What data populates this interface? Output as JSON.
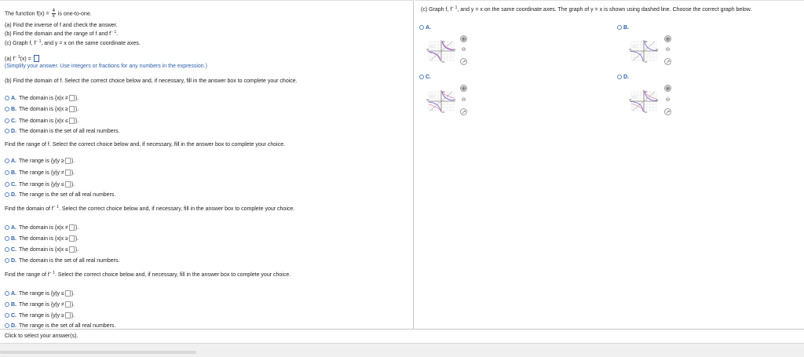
{
  "problem": {
    "intro_prefix": "The function f(x) =",
    "intro_frac_num": "4",
    "intro_frac_den": "x",
    "intro_suffix": "is one-to-one.",
    "part_a": "(a) Find the inverse of f and check the answer.",
    "part_b_prefix": "(b) Find the domain and the range of f and f",
    "part_c_prefix": "(c) Graph f, f",
    "part_c_suffix": ", and y = x on the same coordinate axes.",
    "superscript": "− 1",
    "part_b_suffix": "."
  },
  "answer_a": {
    "prefix": "(a) f",
    "suffix": "(x) =",
    "hint": "(Simplify your answer. Use integers or fractions for any numbers in the expression.)"
  },
  "question_domain_f": "(b) Find the domain of f. Select the correct choice below and, if necessary, fill in the answer box to complete your choice.",
  "options_domain_f": [
    {
      "letter": "A.",
      "text": "The domain is {x|x ≠",
      "end": "}."
    },
    {
      "letter": "B.",
      "text": "The domain is {x|x ≥",
      "end": "}."
    },
    {
      "letter": "C.",
      "text": "The domain is {x|x ≤",
      "end": "}."
    },
    {
      "letter": "D.",
      "text": "The domain is the set of all real numbers.",
      "end": ""
    }
  ],
  "question_range_f": "Find the range of f. Select the correct choice below and, if necessary, fill in the answer box to complete your choice.",
  "options_range_f": [
    {
      "letter": "A.",
      "text": "The range is {y|y ≥",
      "end": "}."
    },
    {
      "letter": "B.",
      "text": "The range is {y|y ≠",
      "end": "}."
    },
    {
      "letter": "C.",
      "text": "The range is {y|y ≤",
      "end": "}."
    },
    {
      "letter": "D.",
      "text": "The range is the set of all real numbers.",
      "end": ""
    }
  ],
  "question_domain_finv_prefix": "Find the domain of f",
  "question_domain_finv_suffix": ". Select the correct choice below and, if necessary, fill in the answer box to complete your choice.",
  "options_domain_finv": [
    {
      "letter": "A.",
      "text": "The domain is {x|x ≠",
      "end": "}."
    },
    {
      "letter": "B.",
      "text": "The domain is {x|x ≥",
      "end": "}."
    },
    {
      "letter": "C.",
      "text": "The domain is {x|x ≤",
      "end": "}."
    },
    {
      "letter": "D.",
      "text": "The domain is the set of all real numbers.",
      "end": ""
    }
  ],
  "question_range_finv_prefix": "Find the range of f",
  "question_range_finv_suffix": ". Select the correct choice below and, if necessary, fill in the answer box to complete your choice.",
  "options_range_finv": [
    {
      "letter": "A.",
      "text": "The range is {y|y ≤",
      "end": "}."
    },
    {
      "letter": "B.",
      "text": "The range is {y|y ≠",
      "end": "}."
    },
    {
      "letter": "C.",
      "text": "The range is {y|y ≥",
      "end": "}."
    },
    {
      "letter": "D.",
      "text": "The range is the set of all real numbers.",
      "end": ""
    }
  ],
  "right": {
    "question_prefix": "(c) Graph f, f",
    "question_suffix": ", and y = x on the same coordinate axes. The graph of y = x is shown using dashed line. Choose the correct graph below.",
    "graph_options": [
      {
        "letter": "A.",
        "tick_top": "20",
        "tick_bottom": "20",
        "tick_left": "20",
        "tick_right": "20"
      },
      {
        "letter": "B.",
        "tick_top": "20",
        "tick_bottom": "20",
        "tick_left": "20",
        "tick_right": "20"
      },
      {
        "letter": "C.",
        "tick_top": "20",
        "tick_bottom": "20",
        "tick_left": "20",
        "tick_right": "20"
      },
      {
        "letter": "D.",
        "tick_top": "20",
        "tick_bottom": "20",
        "tick_left": "20",
        "tick_right": "20"
      }
    ],
    "zoom_in_glyph": "⊕",
    "zoom_out_glyph": "⊖",
    "popout_glyph": "↗"
  },
  "footer": {
    "status": "Click to select your answer(s)."
  },
  "colors": {
    "accent": "#2b5fa8",
    "graph_curve": "#7a5bd1",
    "graph_pink": "#e06aa0"
  }
}
